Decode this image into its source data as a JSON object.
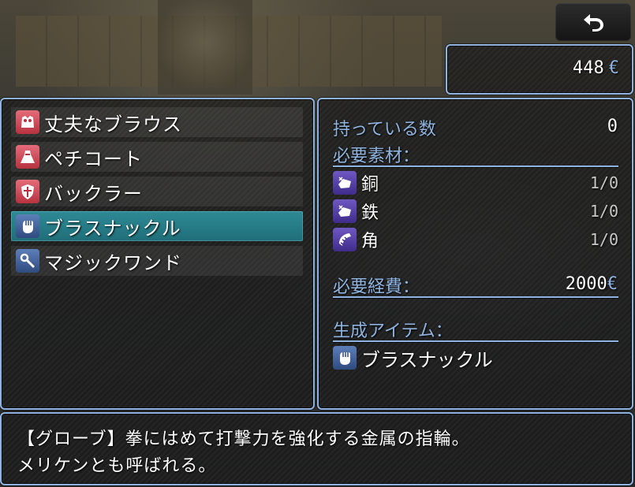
{
  "gold": {
    "amount": "448",
    "unit": "€"
  },
  "items": [
    {
      "label": "丈夫なブラウス",
      "icon": "blouse-icon"
    },
    {
      "label": "ペチコート",
      "icon": "petticoat-icon"
    },
    {
      "label": "バックラー",
      "icon": "buckler-shield-icon"
    },
    {
      "label": "ブラスナックル",
      "icon": "glove-icon"
    },
    {
      "label": "マジックワンド",
      "icon": "wand-icon"
    }
  ],
  "selected_index": 3,
  "detail": {
    "owned_label": "持っている数",
    "owned_value": "0",
    "materials_label": "必要素材：",
    "materials": [
      {
        "name": "銅",
        "count": "1/0",
        "icon": "ore-copper-icon"
      },
      {
        "name": "鉄",
        "count": "1/0",
        "icon": "ore-iron-icon"
      },
      {
        "name": "角",
        "count": "1/0",
        "icon": "horn-icon"
      }
    ],
    "cost_label": "必要経費：",
    "cost_value": "2000",
    "cost_unit": "€",
    "result_label": "生成アイテム：",
    "result_name": "ブラスナックル",
    "result_icon": "glove-icon"
  },
  "help": {
    "line1": "【グローブ】拳にはめて打撃力を強化する金属の指輪。",
    "line2": "メリケンとも呼ばれる。"
  },
  "colors": {
    "system": "#8fb3e0",
    "cursor": "#2e8a96"
  }
}
